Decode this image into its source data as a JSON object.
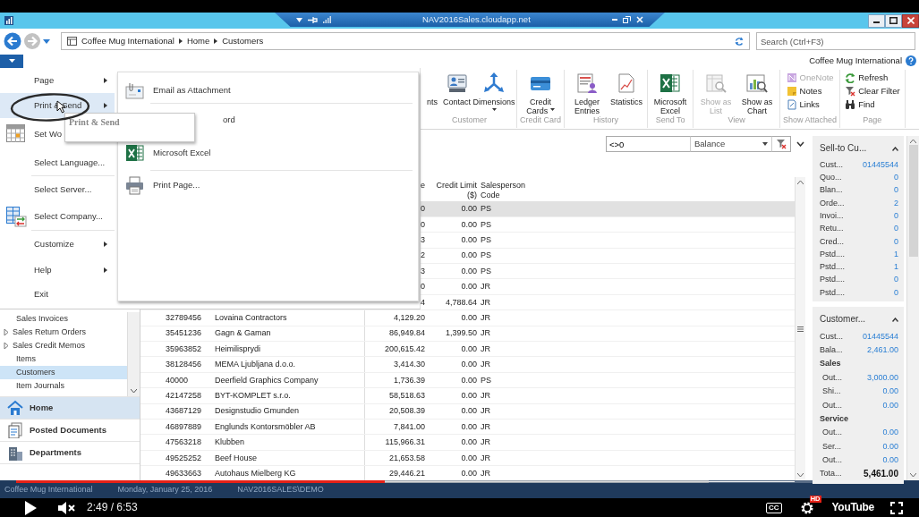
{
  "title_bar": {
    "remote_host": "NAV2016Sales.cloudapp.net"
  },
  "address_bar": {
    "breadcrumb": [
      "Coffee Mug International",
      "Home",
      "Customers"
    ],
    "search": {
      "placeholder": "Search (Ctrl+F3)"
    }
  },
  "company": "Coffee Mug International",
  "ribbon": {
    "groups": [
      {
        "label": "Customer",
        "buttons": [
          {
            "label": "nts",
            "kind": "cut",
            "dropdown": false,
            "disabled": false
          },
          {
            "label": "Contact",
            "kind": "large",
            "dropdown": false,
            "disabled": false
          },
          {
            "label": "Dimensions",
            "kind": "large",
            "dropdown": true,
            "disabled": false
          }
        ]
      },
      {
        "label": "Credit Card",
        "buttons": [
          {
            "label": "Credit Cards",
            "kind": "large",
            "dropdown": true,
            "disabled": false
          }
        ]
      },
      {
        "label": "History",
        "buttons": [
          {
            "label": "Ledger Entries",
            "kind": "large",
            "dropdown": false,
            "disabled": false
          },
          {
            "label": "Statistics",
            "kind": "large",
            "dropdown": false,
            "disabled": false
          }
        ]
      },
      {
        "label": "Send To",
        "buttons": [
          {
            "label": "Microsoft Excel",
            "kind": "large",
            "dropdown": false,
            "disabled": false
          }
        ]
      },
      {
        "label": "View",
        "buttons": [
          {
            "label": "Show as List",
            "kind": "large",
            "dropdown": false,
            "disabled": true
          },
          {
            "label": "Show as Chart",
            "kind": "large",
            "dropdown": false,
            "disabled": false
          }
        ]
      },
      {
        "label": "Show Attached",
        "buttons": [
          {
            "label": "OneNote",
            "kind": "small",
            "dropdown": false,
            "disabled": true
          },
          {
            "label": "Notes",
            "kind": "small",
            "dropdown": false,
            "disabled": false
          },
          {
            "label": "Links",
            "kind": "small",
            "dropdown": false,
            "disabled": false
          }
        ]
      },
      {
        "label": "Page",
        "buttons": [
          {
            "label": "Refresh",
            "kind": "small",
            "dropdown": false,
            "disabled": false
          },
          {
            "label": "Clear Filter",
            "kind": "small",
            "dropdown": false,
            "disabled": false
          },
          {
            "label": "Find",
            "kind": "small",
            "dropdown": false,
            "disabled": false
          }
        ]
      }
    ]
  },
  "app_menu": {
    "items": [
      {
        "label": "Page",
        "submenu": true,
        "selected": false
      },
      {
        "label": "Print & Send",
        "submenu": true,
        "selected": true
      },
      {
        "label": "Set Wo",
        "submenu": false,
        "selected": false
      },
      {
        "label": "Select Language...",
        "submenu": false,
        "selected": false
      },
      {
        "label": "Select Server...",
        "submenu": false,
        "selected": false
      },
      {
        "label": "Select Company...",
        "submenu": false,
        "selected": false
      },
      {
        "label": "Customize",
        "submenu": true,
        "selected": false
      },
      {
        "label": "Help",
        "submenu": true,
        "selected": false
      },
      {
        "label": "Exit",
        "submenu": false,
        "selected": false
      }
    ],
    "submenu_items": [
      {
        "label": "Email as Attachment"
      },
      {
        "label": "ord"
      },
      {
        "label": "Microsoft Excel"
      },
      {
        "label": "Print Page..."
      }
    ],
    "tooltip": "Print & Send"
  },
  "filter": {
    "value": "<>0",
    "field": "Balance"
  },
  "table": {
    "columns": [
      {
        "label": "e"
      },
      {
        "label": "Credit Limit ($)"
      },
      {
        "label": "Salesperson Code"
      }
    ],
    "rows": [
      {
        "balance": "0",
        "credit_limit": "0.00",
        "salesperson": "PS",
        "selected": true
      },
      {
        "balance": "0",
        "credit_limit": "0.00",
        "salesperson": "PS",
        "selected": false
      },
      {
        "balance": "3",
        "credit_limit": "0.00",
        "salesperson": "PS",
        "selected": false
      },
      {
        "balance": "2",
        "credit_limit": "0.00",
        "salesperson": "PS",
        "selected": false
      },
      {
        "balance": "3",
        "credit_limit": "0.00",
        "salesperson": "PS",
        "selected": false
      },
      {
        "balance": "0",
        "credit_limit": "0.00",
        "salesperson": "JR",
        "selected": false
      },
      {
        "balance": "4",
        "credit_limit": "4,788.64",
        "salesperson": "JR",
        "selected": false
      },
      {
        "no": "32789456",
        "name": "Lovaina Contractors",
        "balance": "4,129.20",
        "credit_limit": "0.00",
        "salesperson": "JR",
        "selected": false
      },
      {
        "no": "35451236",
        "name": "Gagn & Gaman",
        "balance": "86,949.84",
        "credit_limit": "1,399.50",
        "salesperson": "JR",
        "selected": false
      },
      {
        "no": "35963852",
        "name": "Heimilisprydi",
        "balance": "200,615.42",
        "credit_limit": "0.00",
        "salesperson": "JR",
        "selected": false
      },
      {
        "no": "38128456",
        "name": "MEMA Ljubljana d.o.o.",
        "balance": "3,414.30",
        "credit_limit": "0.00",
        "salesperson": "JR",
        "selected": false
      },
      {
        "no": "40000",
        "name": "Deerfield Graphics Company",
        "balance": "1,736.39",
        "credit_limit": "0.00",
        "salesperson": "PS",
        "selected": false
      },
      {
        "no": "42147258",
        "name": "BYT-KOMPLET s.r.o.",
        "balance": "58,518.63",
        "credit_limit": "0.00",
        "salesperson": "JR",
        "selected": false
      },
      {
        "no": "43687129",
        "name": "Designstudio Gmunden",
        "balance": "20,508.39",
        "credit_limit": "0.00",
        "salesperson": "JR",
        "selected": false
      },
      {
        "no": "46897889",
        "name": "Englunds Kontorsmöbler AB",
        "balance": "7,841.00",
        "credit_limit": "0.00",
        "salesperson": "JR",
        "selected": false
      },
      {
        "no": "47563218",
        "name": "Klubben",
        "balance": "115,966.31",
        "credit_limit": "0.00",
        "salesperson": "JR",
        "selected": false
      },
      {
        "no": "49525252",
        "name": "Beef House",
        "balance": "21,653.58",
        "credit_limit": "0.00",
        "salesperson": "JR",
        "selected": false
      },
      {
        "no": "49633663",
        "name": "Autohaus Mielberg KG",
        "balance": "29,446.21",
        "credit_limit": "0.00",
        "salesperson": "JR",
        "selected": false
      }
    ]
  },
  "navigation": {
    "items": [
      {
        "label": "Sales Invoices",
        "selected": false
      },
      {
        "label": "Sales Return Orders",
        "expanded": false,
        "selected": false
      },
      {
        "label": "Sales Credit Memos",
        "expanded": false,
        "selected": false
      },
      {
        "label": "Items",
        "selected": false
      },
      {
        "label": "Customers",
        "selected": true
      },
      {
        "label": "Item Journals",
        "selected": false
      }
    ],
    "buttons": [
      {
        "label": "Home",
        "selected": true
      },
      {
        "label": "Posted Documents",
        "selected": false
      },
      {
        "label": "Departments",
        "selected": false
      }
    ]
  },
  "factboxes": [
    {
      "title": "Sell-to Cu...",
      "rows": [
        {
          "kind": "field",
          "label": "Cust...",
          "value": "01445544"
        },
        {
          "kind": "field",
          "label": "Quo...",
          "value": "0"
        },
        {
          "kind": "field",
          "label": "Blan...",
          "value": "0"
        },
        {
          "kind": "field",
          "label": "Orde...",
          "value": "2"
        },
        {
          "kind": "field",
          "label": "Invoi...",
          "value": "0"
        },
        {
          "kind": "field",
          "label": "Retu...",
          "value": "0"
        },
        {
          "kind": "field",
          "label": "Cred...",
          "value": "0"
        },
        {
          "kind": "field",
          "label": "Pstd....",
          "value": "1"
        },
        {
          "kind": "field",
          "label": "Pstd....",
          "value": "1"
        },
        {
          "kind": "field",
          "label": "Pstd....",
          "value": "0"
        },
        {
          "kind": "field",
          "label": "Pstd....",
          "value": "0"
        }
      ]
    },
    {
      "title": "Customer...",
      "rows": [
        {
          "kind": "field",
          "label": "Cust...",
          "value": "01445544"
        },
        {
          "kind": "field",
          "label": "Bala...",
          "value": "2,461.00"
        },
        {
          "kind": "group",
          "label": "Sales",
          "children": [
            {
              "kind": "field",
              "label": "Out...",
              "value": "3,000.00"
            },
            {
              "kind": "field",
              "label": "Shi...",
              "value": "0.00"
            },
            {
              "kind": "field",
              "label": "Out...",
              "value": "0.00"
            }
          ]
        },
        {
          "kind": "group",
          "label": "Service",
          "children": [
            {
              "kind": "field",
              "label": "Out...",
              "value": "0.00"
            },
            {
              "kind": "field",
              "label": "Ser...",
              "value": "0.00"
            },
            {
              "kind": "field",
              "label": "Out...",
              "value": "0.00"
            }
          ]
        },
        {
          "kind": "total",
          "label": "Tota...",
          "value": "5,461.00"
        }
      ]
    }
  ],
  "status_bar": [
    "Coffee Mug International",
    "Monday, January 25, 2016",
    "NAV2016SALES\\DEMO"
  ],
  "video_player": {
    "level": 0.415,
    "muted": true,
    "time": "2:49 / 6:53",
    "captions": "CC",
    "hd": "HD",
    "logo": "YouTube"
  }
}
